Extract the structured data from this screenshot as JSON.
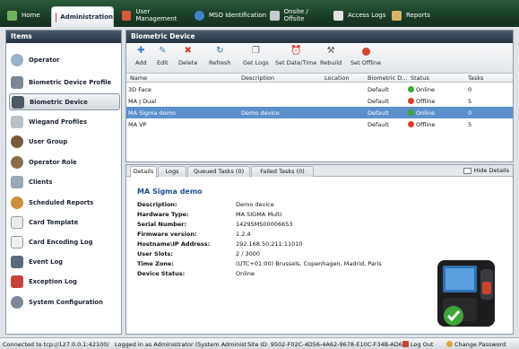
{
  "top_tabs": [
    {
      "label": "Home",
      "icon": "home-icon"
    },
    {
      "label": "Administration",
      "icon": "administration-icon"
    },
    {
      "label": "User Management",
      "icon": "user-management-icon"
    },
    {
      "label": "MSO Identification",
      "icon": "globe-icon"
    },
    {
      "label": "Onsite / Offsite",
      "icon": "building-icon"
    },
    {
      "label": "Access Logs",
      "icon": "log-icon"
    },
    {
      "label": "Reports",
      "icon": "reports-icon"
    }
  ],
  "left_panel": {
    "title": "Items",
    "items": [
      {
        "label": "Operator",
        "icon": "operator-icon"
      },
      {
        "label": "Biometric Device Profile",
        "icon": "device-profile-icon"
      },
      {
        "label": "Biometric Device",
        "icon": "biometric-device-icon"
      },
      {
        "label": "Wiegand Profiles",
        "icon": "wiegand-icon"
      },
      {
        "label": "User Group",
        "icon": "user-group-icon"
      },
      {
        "label": "Operator Role",
        "icon": "operator-role-icon"
      },
      {
        "label": "Clients",
        "icon": "clients-icon"
      },
      {
        "label": "Scheduled Reports",
        "icon": "scheduled-reports-icon"
      },
      {
        "label": "Card Template",
        "icon": "card-template-icon"
      },
      {
        "label": "Card Encoding Log",
        "icon": "card-encoding-icon"
      },
      {
        "label": "Event Log",
        "icon": "event-log-icon"
      },
      {
        "label": "Exception Log",
        "icon": "exception-log-icon"
      },
      {
        "label": "System Configuration",
        "icon": "system-config-icon"
      }
    ]
  },
  "main_panel": {
    "title": "Biometric Device",
    "toolbar": [
      {
        "label": "Add",
        "icon": "add-icon"
      },
      {
        "label": "Edit",
        "icon": "edit-icon"
      },
      {
        "label": "Delete",
        "icon": "delete-icon"
      },
      {
        "label": "Refresh",
        "icon": "refresh-icon"
      },
      {
        "label": "Get Logs",
        "icon": "get-logs-icon"
      },
      {
        "label": "Set Date/Time",
        "icon": "clock-icon"
      },
      {
        "label": "Rebuild",
        "icon": "wrench-icon"
      },
      {
        "label": "Set Offline",
        "icon": "set-offline-icon"
      }
    ],
    "columns": [
      "Name",
      "Description",
      "Location",
      "Biometric D...",
      "Status",
      "Tasks"
    ],
    "rows": [
      {
        "name": "3D Face",
        "description": "",
        "location": "",
        "profile": "Default",
        "status": "Online",
        "tasks": "0"
      },
      {
        "name": "MA J Dual",
        "description": "",
        "location": "",
        "profile": "Default",
        "status": "Offline",
        "tasks": "5"
      },
      {
        "name": "MA Sigma demo",
        "description": "Demo device",
        "location": "",
        "profile": "Default",
        "status": "Online",
        "tasks": "0"
      },
      {
        "name": "MA VP",
        "description": "",
        "location": "",
        "profile": "Default",
        "status": "Offline",
        "tasks": "5"
      }
    ]
  },
  "details": {
    "tabs": [
      "Details",
      "Logs",
      "Queued Tasks (0)",
      "Failed Tasks (0)"
    ],
    "hide_label": "Hide Details",
    "device_title": "MA Sigma demo",
    "fields": [
      {
        "label": "Description:",
        "value": "Demo device"
      },
      {
        "label": "Hardware Type:",
        "value": "MA SIGMA Multi"
      },
      {
        "label": "Serial Number:",
        "value": "1429SMS00006653"
      },
      {
        "label": "Firmware version:",
        "value": "1.2.4"
      },
      {
        "label": "Hostname\\IP Address:",
        "value": "192.168.50.211:11010"
      },
      {
        "label": "User Slots:",
        "value": "2 / 3000"
      },
      {
        "label": "Time Zone:",
        "value": "(UTC+01:00) Brussels, Copenhagen, Madrid, Paris"
      },
      {
        "label": "Device Status:",
        "value": "Online"
      }
    ]
  },
  "status_bar": {
    "connection": "Connected to tcp://127.0.0.1:42100/",
    "login": "Logged in as Administrator (System Administ",
    "site": "Site ID: 9502-F02C-4D56-4A62-9678-E10C-F34B-AD62",
    "logout": "Log Out",
    "change_password": "Change Password"
  },
  "colors": {
    "online": "#3aa83a",
    "offline": "#d6402b",
    "selection": "#5d8fcc",
    "title_blue": "#1f4f94"
  }
}
